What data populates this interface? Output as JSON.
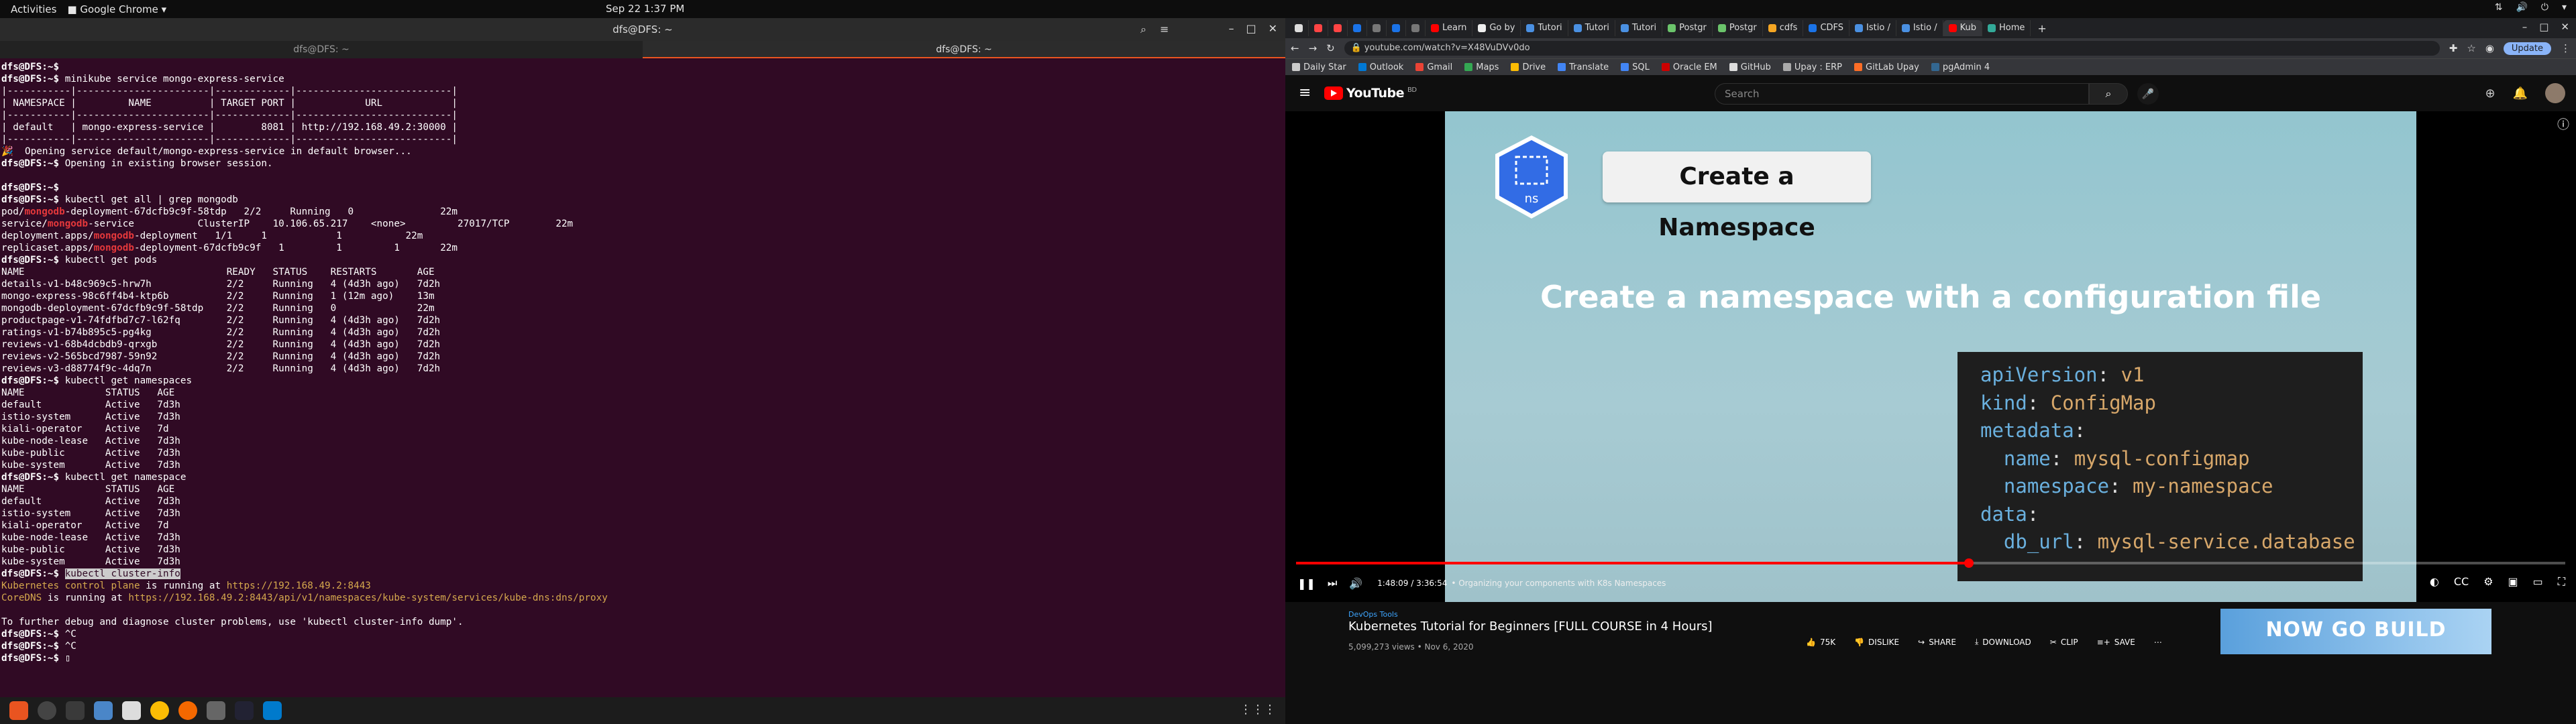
{
  "system": {
    "activities": "Activities",
    "app_name": "Google Chrome",
    "clock": "Sep 22  1:37 PM"
  },
  "terminal": {
    "title": "dfs@DFS: ~",
    "tabs": [
      "dfs@DFS: ~",
      "dfs@DFS: ~"
    ],
    "lines": [
      {
        "segments": [
          {
            "t": "dfs@DFS:~$ ",
            "c": "p"
          },
          {
            "t": "",
            "c": ""
          }
        ]
      },
      {
        "segments": [
          {
            "t": "dfs@DFS:~$ ",
            "c": "p"
          },
          {
            "t": "minikube service mongo-express-service",
            "c": ""
          }
        ]
      },
      {
        "segments": [
          {
            "t": "|-----------|-----------------------|-------------|---------------------------|",
            "c": ""
          }
        ]
      },
      {
        "segments": [
          {
            "t": "| NAMESPACE |         NAME          | TARGET PORT |            URL            |",
            "c": ""
          }
        ]
      },
      {
        "segments": [
          {
            "t": "|-----------|-----------------------|-------------|---------------------------|",
            "c": ""
          }
        ]
      },
      {
        "segments": [
          {
            "t": "| default   | mongo-express-service |        8081 | http://192.168.49.2:30000 |",
            "c": ""
          }
        ]
      },
      {
        "segments": [
          {
            "t": "|-----------|-----------------------|-------------|---------------------------|",
            "c": ""
          }
        ]
      },
      {
        "segments": [
          {
            "t": "🎉  Opening service default/mongo-express-service in default browser...",
            "c": ""
          }
        ]
      },
      {
        "segments": [
          {
            "t": "dfs@DFS:~$ ",
            "c": "p"
          },
          {
            "t": "Opening in existing browser session.",
            "c": ""
          }
        ]
      },
      {
        "segments": [
          {
            "t": "",
            "c": ""
          }
        ]
      },
      {
        "segments": [
          {
            "t": "dfs@DFS:~$ ",
            "c": "p"
          },
          {
            "t": "",
            "c": ""
          }
        ]
      },
      {
        "segments": [
          {
            "t": "dfs@DFS:~$ ",
            "c": "p"
          },
          {
            "t": "kubectl get all | grep mongodb",
            "c": ""
          }
        ]
      },
      {
        "segments": [
          {
            "t": "pod/",
            "c": ""
          },
          {
            "t": "mongodb",
            "c": "red"
          },
          {
            "t": "-deployment-67dcfb9c9f-58tdp   2/2     Running   0               22m",
            "c": ""
          }
        ]
      },
      {
        "segments": [
          {
            "t": "service/",
            "c": ""
          },
          {
            "t": "mongodb",
            "c": "red"
          },
          {
            "t": "-service           ClusterIP    10.106.65.217    <none>         27017/TCP        22m",
            "c": ""
          }
        ]
      },
      {
        "segments": [
          {
            "t": "deployment.apps/",
            "c": ""
          },
          {
            "t": "mongodb",
            "c": "red"
          },
          {
            "t": "-deployment   1/1     1            1           22m",
            "c": ""
          }
        ]
      },
      {
        "segments": [
          {
            "t": "replicaset.apps/",
            "c": ""
          },
          {
            "t": "mongodb",
            "c": "red"
          },
          {
            "t": "-deployment-67dcfb9c9f   1         1         1       22m",
            "c": ""
          }
        ]
      },
      {
        "segments": [
          {
            "t": "dfs@DFS:~$ ",
            "c": "p"
          },
          {
            "t": "kubectl get pods",
            "c": ""
          }
        ]
      },
      {
        "segments": [
          {
            "t": "NAME                                   READY   STATUS    RESTARTS       AGE",
            "c": ""
          }
        ]
      },
      {
        "segments": [
          {
            "t": "details-v1-b48c969c5-hrw7h             2/2     Running   4 (4d3h ago)   7d2h",
            "c": ""
          }
        ]
      },
      {
        "segments": [
          {
            "t": "mongo-express-98c6ff4b4-ktp6b          2/2     Running   1 (12m ago)    13m",
            "c": ""
          }
        ]
      },
      {
        "segments": [
          {
            "t": "mongodb-deployment-67dcfb9c9f-58tdp    2/2     Running   0              22m",
            "c": ""
          }
        ]
      },
      {
        "segments": [
          {
            "t": "productpage-v1-74fdfbd7c7-l62fq        2/2     Running   4 (4d3h ago)   7d2h",
            "c": ""
          }
        ]
      },
      {
        "segments": [
          {
            "t": "ratings-v1-b74b895c5-pg4kg             2/2     Running   4 (4d3h ago)   7d2h",
            "c": ""
          }
        ]
      },
      {
        "segments": [
          {
            "t": "reviews-v1-68b4dcbdb9-qrxgb            2/2     Running   4 (4d3h ago)   7d2h",
            "c": ""
          }
        ]
      },
      {
        "segments": [
          {
            "t": "reviews-v2-565bcd7987-59n92            2/2     Running   4 (4d3h ago)   7d2h",
            "c": ""
          }
        ]
      },
      {
        "segments": [
          {
            "t": "reviews-v3-d88774f9c-4dq7n             2/2     Running   4 (4d3h ago)   7d2h",
            "c": ""
          }
        ]
      },
      {
        "segments": [
          {
            "t": "dfs@DFS:~$ ",
            "c": "p"
          },
          {
            "t": "kubectl get namespaces",
            "c": ""
          }
        ]
      },
      {
        "segments": [
          {
            "t": "NAME              STATUS   AGE",
            "c": ""
          }
        ]
      },
      {
        "segments": [
          {
            "t": "default           Active   7d3h",
            "c": ""
          }
        ]
      },
      {
        "segments": [
          {
            "t": "istio-system      Active   7d3h",
            "c": ""
          }
        ]
      },
      {
        "segments": [
          {
            "t": "kiali-operator    Active   7d",
            "c": ""
          }
        ]
      },
      {
        "segments": [
          {
            "t": "kube-node-lease   Active   7d3h",
            "c": ""
          }
        ]
      },
      {
        "segments": [
          {
            "t": "kube-public       Active   7d3h",
            "c": ""
          }
        ]
      },
      {
        "segments": [
          {
            "t": "kube-system       Active   7d3h",
            "c": ""
          }
        ]
      },
      {
        "segments": [
          {
            "t": "dfs@DFS:~$ ",
            "c": "p"
          },
          {
            "t": "kubectl get namespace",
            "c": ""
          }
        ]
      },
      {
        "segments": [
          {
            "t": "NAME              STATUS   AGE",
            "c": ""
          }
        ]
      },
      {
        "segments": [
          {
            "t": "default           Active   7d3h",
            "c": ""
          }
        ]
      },
      {
        "segments": [
          {
            "t": "istio-system      Active   7d3h",
            "c": ""
          }
        ]
      },
      {
        "segments": [
          {
            "t": "kiali-operator    Active   7d",
            "c": ""
          }
        ]
      },
      {
        "segments": [
          {
            "t": "kube-node-lease   Active   7d3h",
            "c": ""
          }
        ]
      },
      {
        "segments": [
          {
            "t": "kube-public       Active   7d3h",
            "c": ""
          }
        ]
      },
      {
        "segments": [
          {
            "t": "kube-system       Active   7d3h",
            "c": ""
          }
        ]
      },
      {
        "segments": [
          {
            "t": "dfs@DFS:~$ ",
            "c": "p"
          },
          {
            "t": "kubectl cluster-info",
            "c": "hl"
          }
        ]
      },
      {
        "segments": [
          {
            "t": "Kubernetes control plane",
            "c": "orng"
          },
          {
            "t": " is running at ",
            "c": ""
          },
          {
            "t": "https://192.168.49.2:8443",
            "c": "orng"
          }
        ]
      },
      {
        "segments": [
          {
            "t": "CoreDNS",
            "c": "orng"
          },
          {
            "t": " is running at ",
            "c": ""
          },
          {
            "t": "https://192.168.49.2:8443/api/v1/namespaces/kube-system/services/kube-dns:dns/proxy",
            "c": "orng"
          }
        ]
      },
      {
        "segments": [
          {
            "t": "",
            "c": ""
          }
        ]
      },
      {
        "segments": [
          {
            "t": "To further debug and diagnose cluster problems, use 'kubectl cluster-info dump'.",
            "c": ""
          }
        ]
      },
      {
        "segments": [
          {
            "t": "dfs@DFS:~$ ",
            "c": "p"
          },
          {
            "t": "^C",
            "c": ""
          }
        ]
      },
      {
        "segments": [
          {
            "t": "dfs@DFS:~$ ",
            "c": "p"
          },
          {
            "t": "^C",
            "c": ""
          }
        ]
      },
      {
        "segments": [
          {
            "t": "dfs@DFS:~$ ",
            "c": "p"
          },
          {
            "t": "▯",
            "c": ""
          }
        ]
      }
    ]
  },
  "browser": {
    "tabs": [
      {
        "label": "",
        "color": "#ddd"
      },
      {
        "label": "",
        "color": "#f44"
      },
      {
        "label": "",
        "color": "#f44"
      },
      {
        "label": "",
        "color": "#1a73e8"
      },
      {
        "label": "",
        "color": "#777"
      },
      {
        "label": "",
        "color": "#1a73e8"
      },
      {
        "label": "",
        "color": "#777"
      },
      {
        "label": "Learn",
        "color": "#f00"
      },
      {
        "label": "Go by",
        "color": "#eee"
      },
      {
        "label": "Tutori",
        "color": "#4a90e2"
      },
      {
        "label": "Tutori",
        "color": "#4a90e2"
      },
      {
        "label": "Tutori",
        "color": "#4a90e2"
      },
      {
        "label": "Postgr",
        "color": "#6bc46b"
      },
      {
        "label": "Postgr",
        "color": "#6bc46b"
      },
      {
        "label": "cdfs",
        "color": "#f5a623"
      },
      {
        "label": "CDFS",
        "color": "#1a73e8"
      },
      {
        "label": "Istio /",
        "color": "#4a90e2"
      },
      {
        "label": "Istio /",
        "color": "#4a90e2"
      },
      {
        "label": "Kub",
        "color": "#f00"
      },
      {
        "label": "Home",
        "color": "#3a9"
      }
    ],
    "url": "youtube.com/watch?v=X48VuDVv0do",
    "update_label": "Update",
    "bookmarks": [
      {
        "label": "Daily Star",
        "color": "#ccc"
      },
      {
        "label": "Outlook",
        "color": "#0078d4"
      },
      {
        "label": "Gmail",
        "color": "#ea4335"
      },
      {
        "label": "Maps",
        "color": "#34a853"
      },
      {
        "label": "Drive",
        "color": "#fbbc04"
      },
      {
        "label": "Translate",
        "color": "#4285f4"
      },
      {
        "label": "SQL",
        "color": "#4285f4"
      },
      {
        "label": "Oracle EM",
        "color": "#c00"
      },
      {
        "label": "GitHub",
        "color": "#ddd"
      },
      {
        "label": "Upay : ERP",
        "color": "#aaa"
      },
      {
        "label": "GitLab Upay",
        "color": "#fc6d26"
      },
      {
        "label": "pgAdmin 4",
        "color": "#336791"
      }
    ]
  },
  "youtube": {
    "logo_text": "YouTube",
    "logo_sup": "BD",
    "search_placeholder": "Search",
    "slide": {
      "badge_text": "ns",
      "title": "Create a Namespace",
      "headline": "Create a namespace with a configuration file",
      "code": [
        [
          {
            "t": "apiVersion",
            "c": "k"
          },
          {
            "t": ": ",
            "c": "w"
          },
          {
            "t": "v1",
            "c": "v"
          }
        ],
        [
          {
            "t": "kind",
            "c": "k"
          },
          {
            "t": ": ",
            "c": "w"
          },
          {
            "t": "ConfigMap",
            "c": "v"
          }
        ],
        [
          {
            "t": "metadata",
            "c": "k"
          },
          {
            "t": ":",
            "c": "w"
          }
        ],
        [
          {
            "t": "  name",
            "c": "k"
          },
          {
            "t": ": ",
            "c": "w"
          },
          {
            "t": "mysql-configmap",
            "c": "v"
          }
        ],
        [
          {
            "t": "  namespace",
            "c": "k"
          },
          {
            "t": ": ",
            "c": "w"
          },
          {
            "t": "my-namespace",
            "c": "v"
          }
        ],
        [
          {
            "t": "data",
            "c": "k"
          },
          {
            "t": ":",
            "c": "w"
          }
        ],
        [
          {
            "t": "  db_url",
            "c": "k"
          },
          {
            "t": ": ",
            "c": "w"
          },
          {
            "t": "mysql-service.database",
            "c": "v"
          }
        ]
      ]
    },
    "player": {
      "time": "1:48:09 / 3:36:54",
      "chapter": "• Organizing your components with K8s Namespaces",
      "progress": 0.53
    },
    "video": {
      "channel": "DevOps Tools",
      "title": "Kubernetes Tutorial for Beginners [FULL COURSE in 4 Hours]",
      "stats": "5,099,273 views • Nov 6, 2020",
      "likes": "75K",
      "dislike": "DISLIKE",
      "share": "SHARE",
      "download": "DOWNLOAD",
      "clip": "CLIP",
      "save": "SAVE"
    },
    "ad": {
      "text": "NOW GO BUILD"
    }
  }
}
